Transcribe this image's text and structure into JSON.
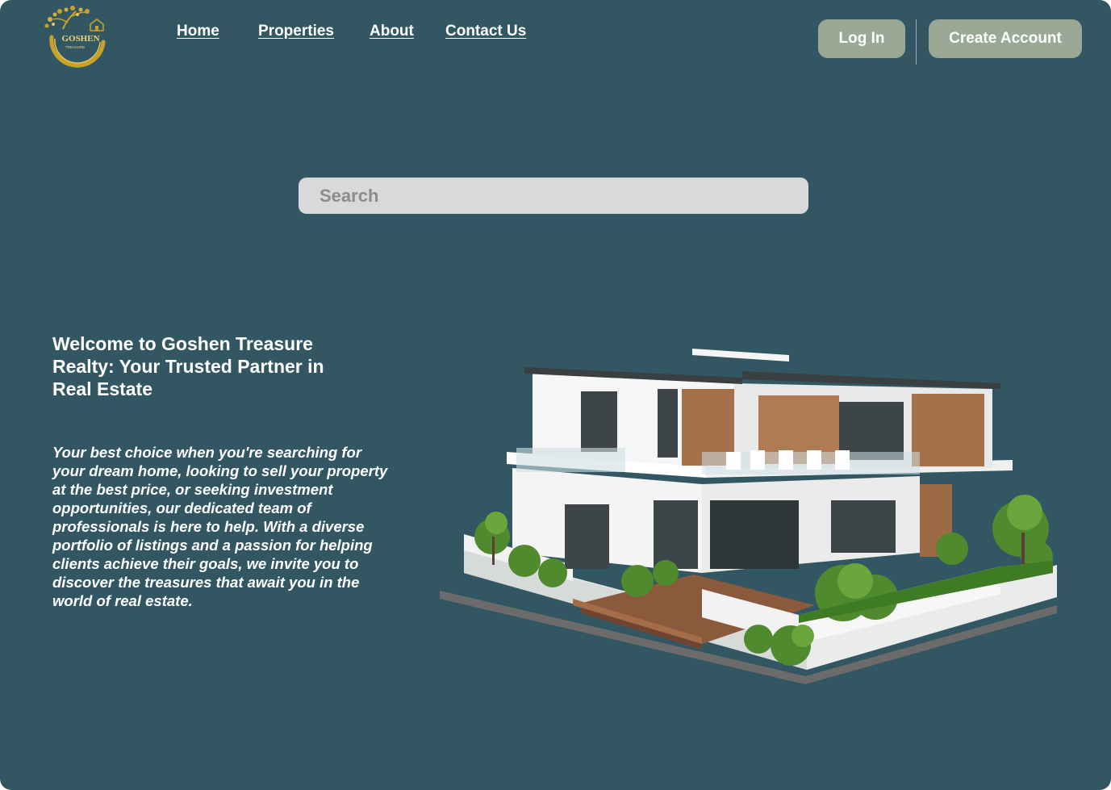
{
  "brand": {
    "logo_text": "GOSHEN",
    "logo_subtext": "TREASURE"
  },
  "nav": {
    "items": [
      {
        "label": "Home"
      },
      {
        "label": "Properties"
      },
      {
        "label": "About"
      },
      {
        "label": "Contact Us"
      }
    ]
  },
  "auth": {
    "login_label": "Log In",
    "create_label": "Create Account"
  },
  "search": {
    "placeholder": "Search"
  },
  "hero": {
    "title": "Welcome to Goshen Treasure Realty: Your Trusted Partner in Real Estate",
    "body": "Your best choice when you're searching for your dream home, looking to sell your property at the best price, or seeking investment opportunities, our dedicated team of professionals is here to help. With a diverse portfolio of listings and a passion for helping clients achieve their goals, we invite you to discover the treasures that await you in the world of real estate."
  },
  "colors": {
    "background": "#335762",
    "button": "#9aa996",
    "search_bg": "#d9d9d9",
    "logo_gold": "#c9a227"
  },
  "icons": {
    "logo": "goshen-tree-logo",
    "hero_image": "modern-house-illustration"
  }
}
